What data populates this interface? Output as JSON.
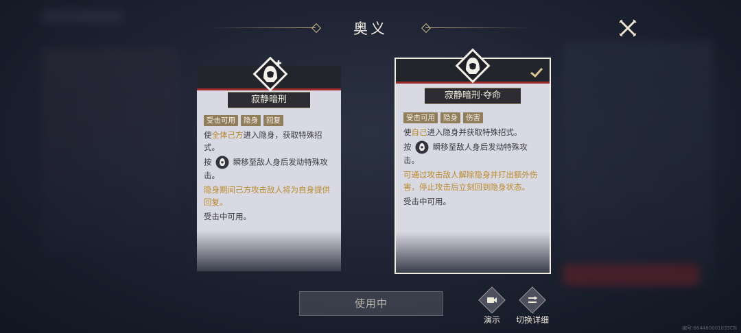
{
  "header": {
    "title": "奥义"
  },
  "cards": [
    {
      "name": "寂静暗刑",
      "tags": [
        "受击可用",
        "隐身",
        "回复"
      ],
      "lines": {
        "l1_pre": "使",
        "l1_hl": "全体己方",
        "l1_post": "进入隐身，获取特殊招式。",
        "l2_pre": "按",
        "l2_post": "瞬移至敌人身后发动特殊攻击。",
        "l3": "隐身期间己方攻击敌人将为自身提供回复。",
        "l4": "受击中可用。"
      }
    },
    {
      "name": "寂静暗刑·夺命",
      "tags": [
        "受击可用",
        "隐身",
        "伤害"
      ],
      "lines": {
        "l1_pre": "使",
        "l1_hl": "自己",
        "l1_post": "进入隐身并获取特殊招式。",
        "l2_pre": "按",
        "l2_post": "瞬移至敌人身后发动特殊攻击。",
        "l3": "可通过攻击敌人解除隐身并打出额外伤害，停止攻击后立刻回到隐身状态。",
        "l4": "受击中可用。"
      }
    }
  ],
  "bottom": {
    "use_label": "使用中",
    "demo_label": "演示",
    "switch_label": "切换详细"
  },
  "watermark": "编号:664480001033CN",
  "colors": {
    "accent_gold": "#b98a2c",
    "tag_bg": "#8f7d5c",
    "red_stripe": "#9c2b2b"
  },
  "icons": [
    "close-icon",
    "hooded-figure-icon",
    "plus-icon",
    "check-icon",
    "skill-button-icon",
    "video-icon",
    "switch-detail-icon"
  ]
}
